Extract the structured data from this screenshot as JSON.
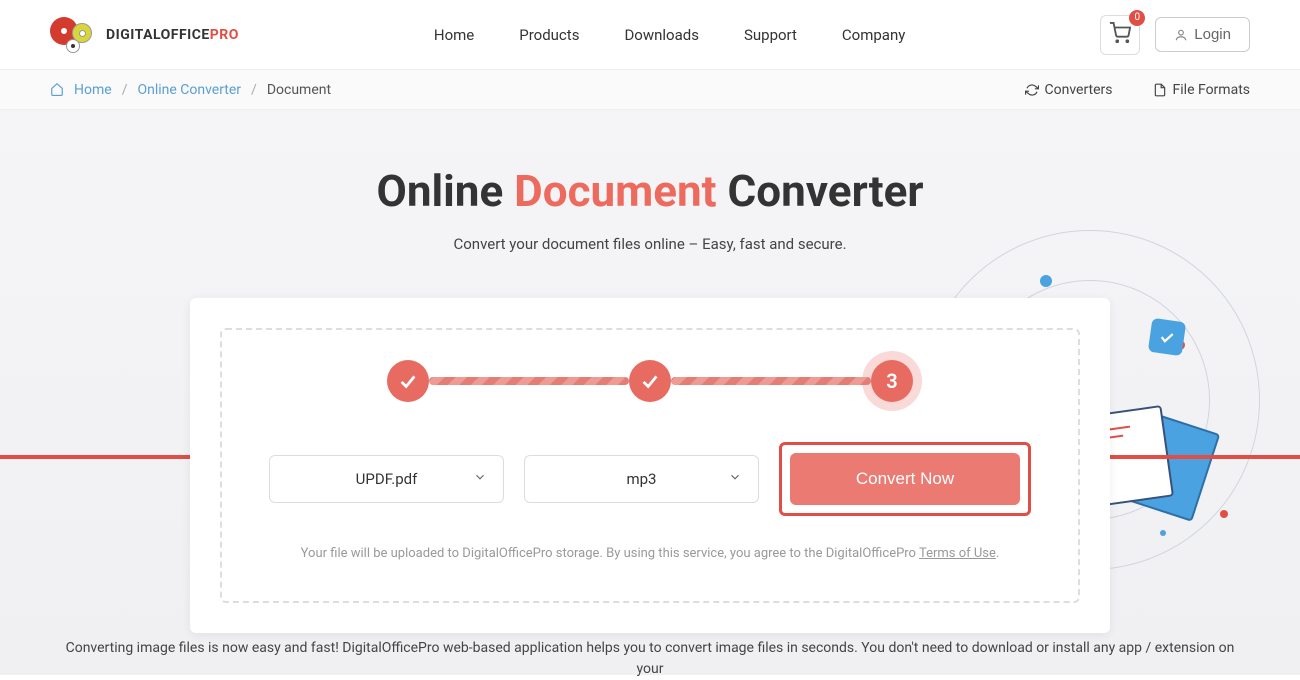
{
  "brand": {
    "text_main": "DIGITALOFFICE",
    "text_suffix": "PRO"
  },
  "nav": {
    "home": "Home",
    "products": "Products",
    "downloads": "Downloads",
    "support": "Support",
    "company": "Company"
  },
  "cart": {
    "count": "0"
  },
  "login": {
    "label": "Login"
  },
  "breadcrumb": {
    "home": "Home",
    "converter": "Online Converter",
    "current": "Document"
  },
  "subnav": {
    "converters": "Converters",
    "fileformats": "File Formats"
  },
  "hero": {
    "title_pre": "Online ",
    "title_accent": "Document",
    "title_post": " Converter",
    "subtitle": "Convert your document files online – Easy, fast and secure."
  },
  "stepper": {
    "step3": "3"
  },
  "inputs": {
    "file": "UPDF.pdf",
    "format": "mp3"
  },
  "convert": {
    "label": "Convert Now"
  },
  "terms": {
    "text": "Your file will be uploaded to DigitalOfficePro storage.  By using this service, you agree to the DigitalOfficePro ",
    "link": "Terms of Use",
    "suffix": "."
  },
  "bottom": "Converting image files is now easy and fast! DigitalOfficePro web-based application helps you to convert image files in seconds. You don't need to download or install any app / extension on your"
}
